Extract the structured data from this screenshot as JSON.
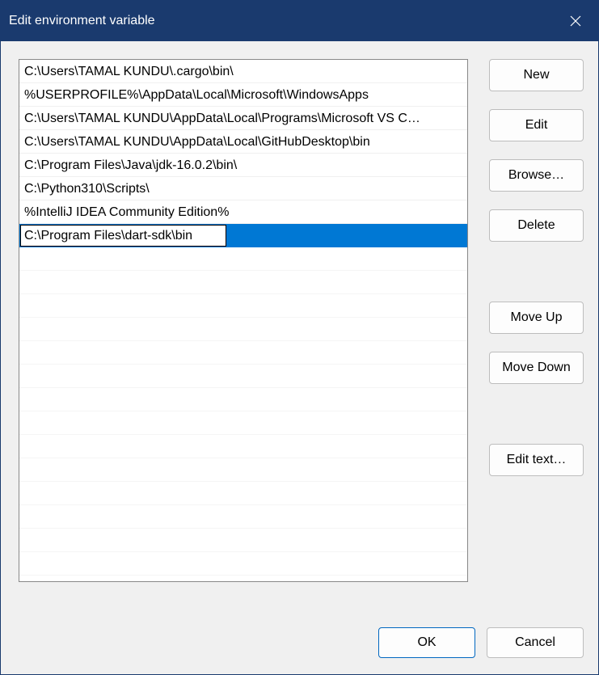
{
  "titlebar": {
    "title": "Edit environment variable"
  },
  "list": {
    "items": [
      "C:\\Users\\TAMAL KUNDU\\.cargo\\bin\\",
      "%USERPROFILE%\\AppData\\Local\\Microsoft\\WindowsApps",
      "C:\\Users\\TAMAL KUNDU\\AppData\\Local\\Programs\\Microsoft VS C…",
      "C:\\Users\\TAMAL KUNDU\\AppData\\Local\\GitHubDesktop\\bin",
      "C:\\Program Files\\Java\\jdk-16.0.2\\bin\\",
      "C:\\Python310\\Scripts\\",
      "%IntelliJ IDEA Community Edition%"
    ],
    "selected_value": "C:\\Program Files\\dart-sdk\\bin"
  },
  "buttons": {
    "new": "New",
    "edit": "Edit",
    "browse": "Browse…",
    "delete": "Delete",
    "move_up": "Move Up",
    "move_down": "Move Down",
    "edit_text": "Edit text…",
    "ok": "OK",
    "cancel": "Cancel"
  }
}
